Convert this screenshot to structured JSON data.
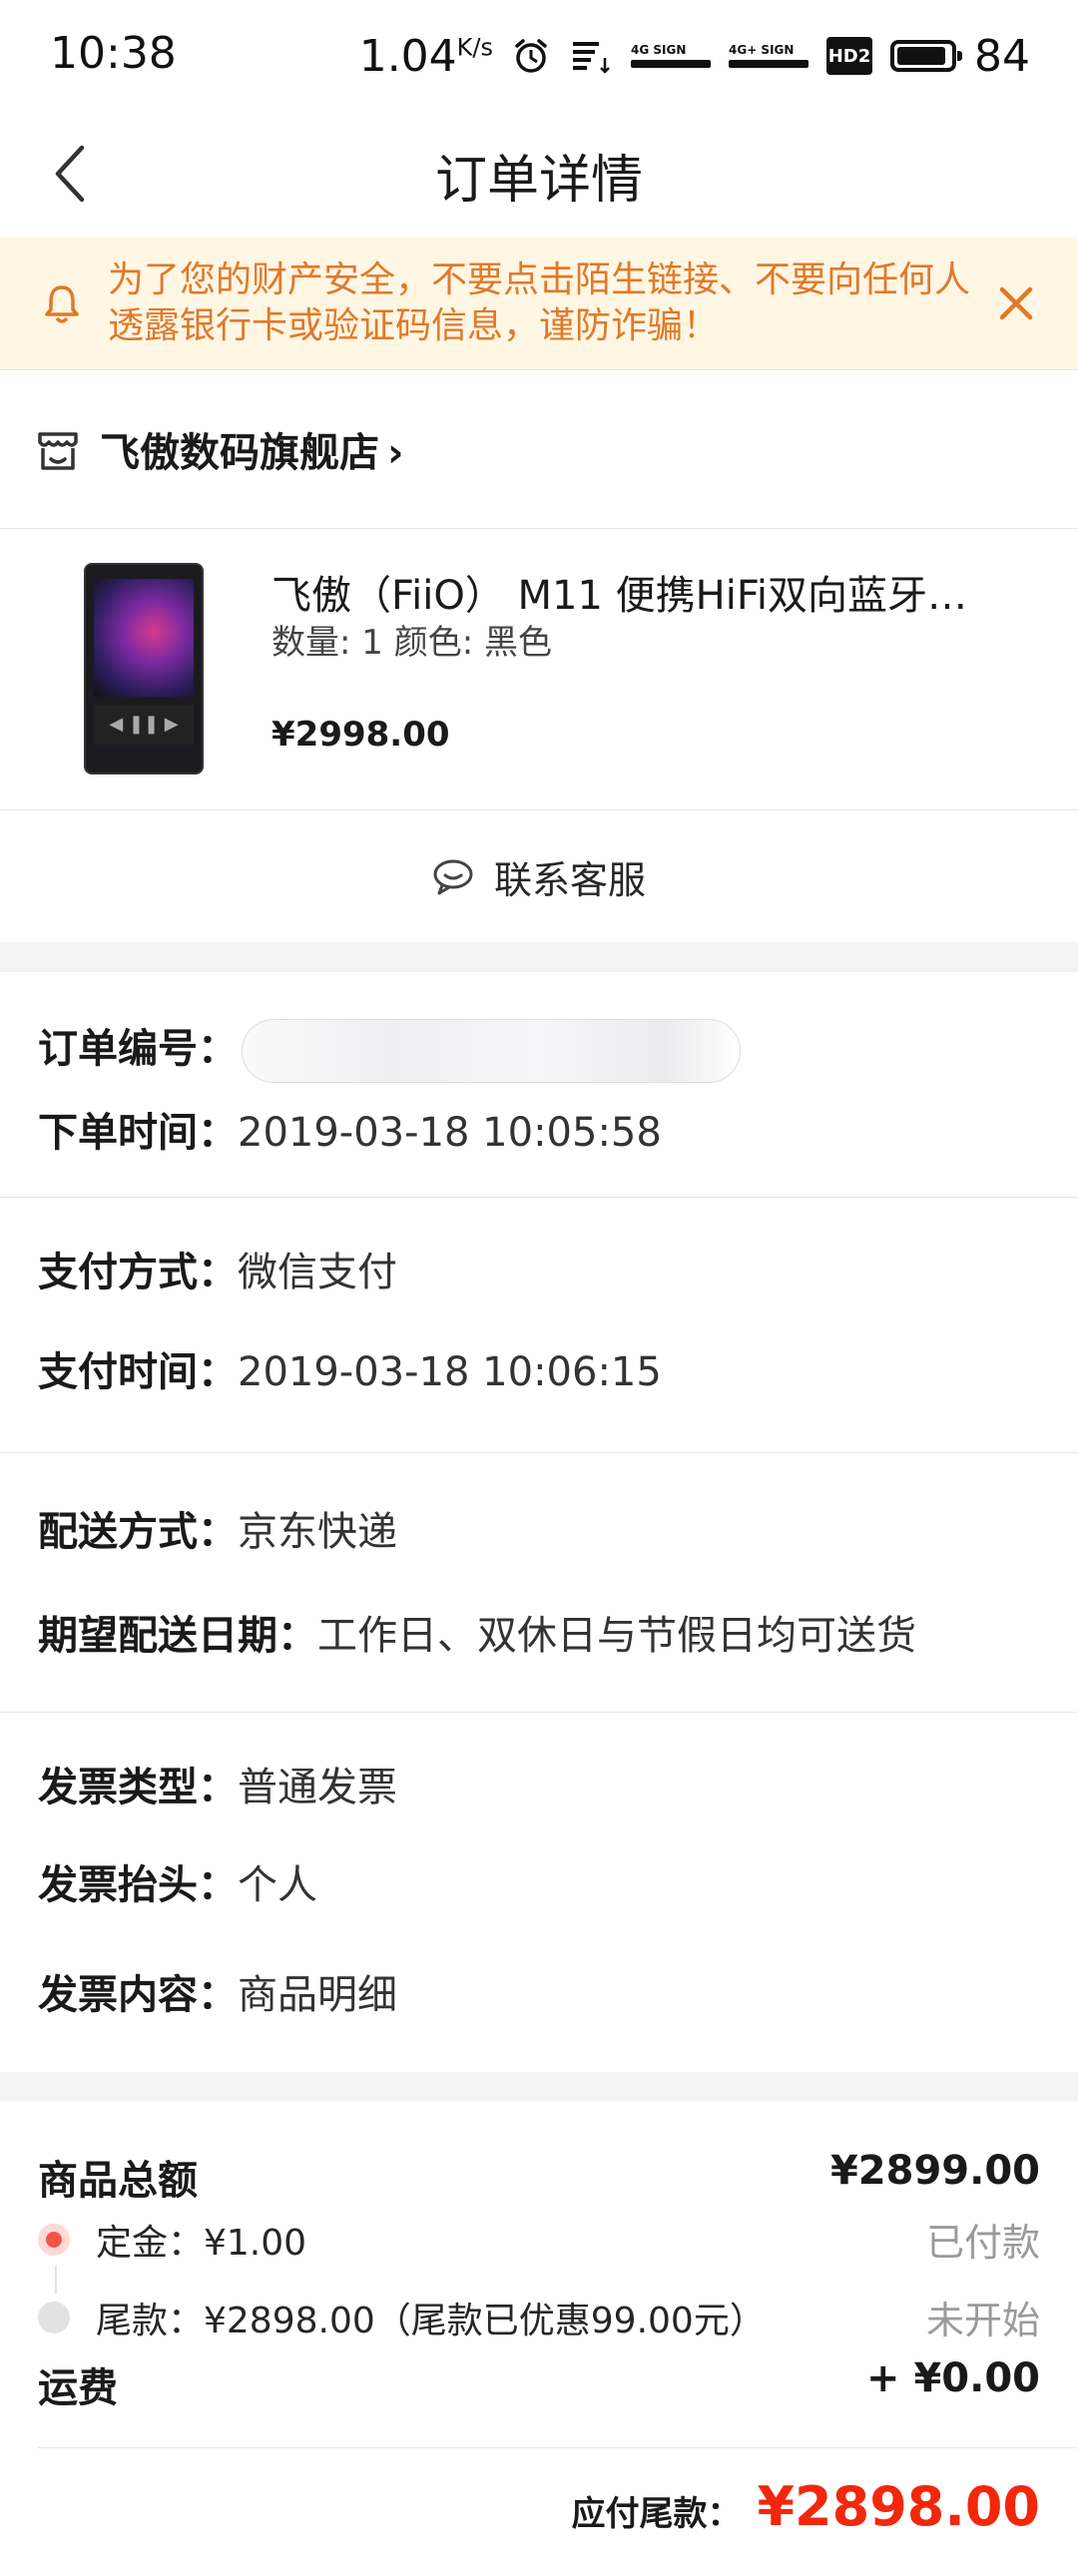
{
  "status_bar": {
    "time": "10:38",
    "net_speed": "1.04",
    "net_unit": "K/s",
    "sim1": "4G SIGN",
    "sim2": "4G+ SIGN",
    "hd": "HD2",
    "battery": "84"
  },
  "nav": {
    "title": "订单详情"
  },
  "notice": {
    "text": "为了您的财产安全，不要点击陌生链接、不要向任何人透露银行卡或验证码信息，谨防诈骗！"
  },
  "shop": {
    "name": "飞傲数码旗舰店",
    "arrow": "›"
  },
  "product": {
    "title": "飞傲（FiiO） M11 便携HiFi双向蓝牙…",
    "spec": "数量: 1 颜色: 黑色",
    "price": "¥2998.00"
  },
  "service": {
    "label": "联系客服"
  },
  "order_info": {
    "order_no_label": "订单编号：",
    "order_time_label": "下单时间：",
    "order_time": "2019-03-18 10:05:58"
  },
  "payment_info": {
    "method_label": "支付方式：",
    "method": "微信支付",
    "time_label": "支付时间：",
    "time": "2019-03-18 10:06:15"
  },
  "delivery_info": {
    "method_label": "配送方式：",
    "method": "京东快递",
    "date_label": "期望配送日期：",
    "date": "工作日、双休日与节假日均可送货"
  },
  "invoice_info": {
    "type_label": "发票类型：",
    "type": "普通发票",
    "title_label": "发票抬头：",
    "title": "个人",
    "content_label": "发票内容：",
    "content": "商品明细"
  },
  "summary": {
    "total_label": "商品总额",
    "total": "¥2899.00",
    "deposit_label": "定金：¥1.00",
    "deposit_status": "已付款",
    "balance_label": "尾款：¥2898.00（尾款已优惠99.00元）",
    "balance_status": "未开始",
    "shipping_label": "运费",
    "shipping": "+ ¥0.00",
    "payable_label": "应付尾款：",
    "payable": "¥2898.00"
  },
  "colors": {
    "accent_red": "#f2270c",
    "notice_bg": "#fff6e3",
    "notice_text": "#e0792a"
  }
}
